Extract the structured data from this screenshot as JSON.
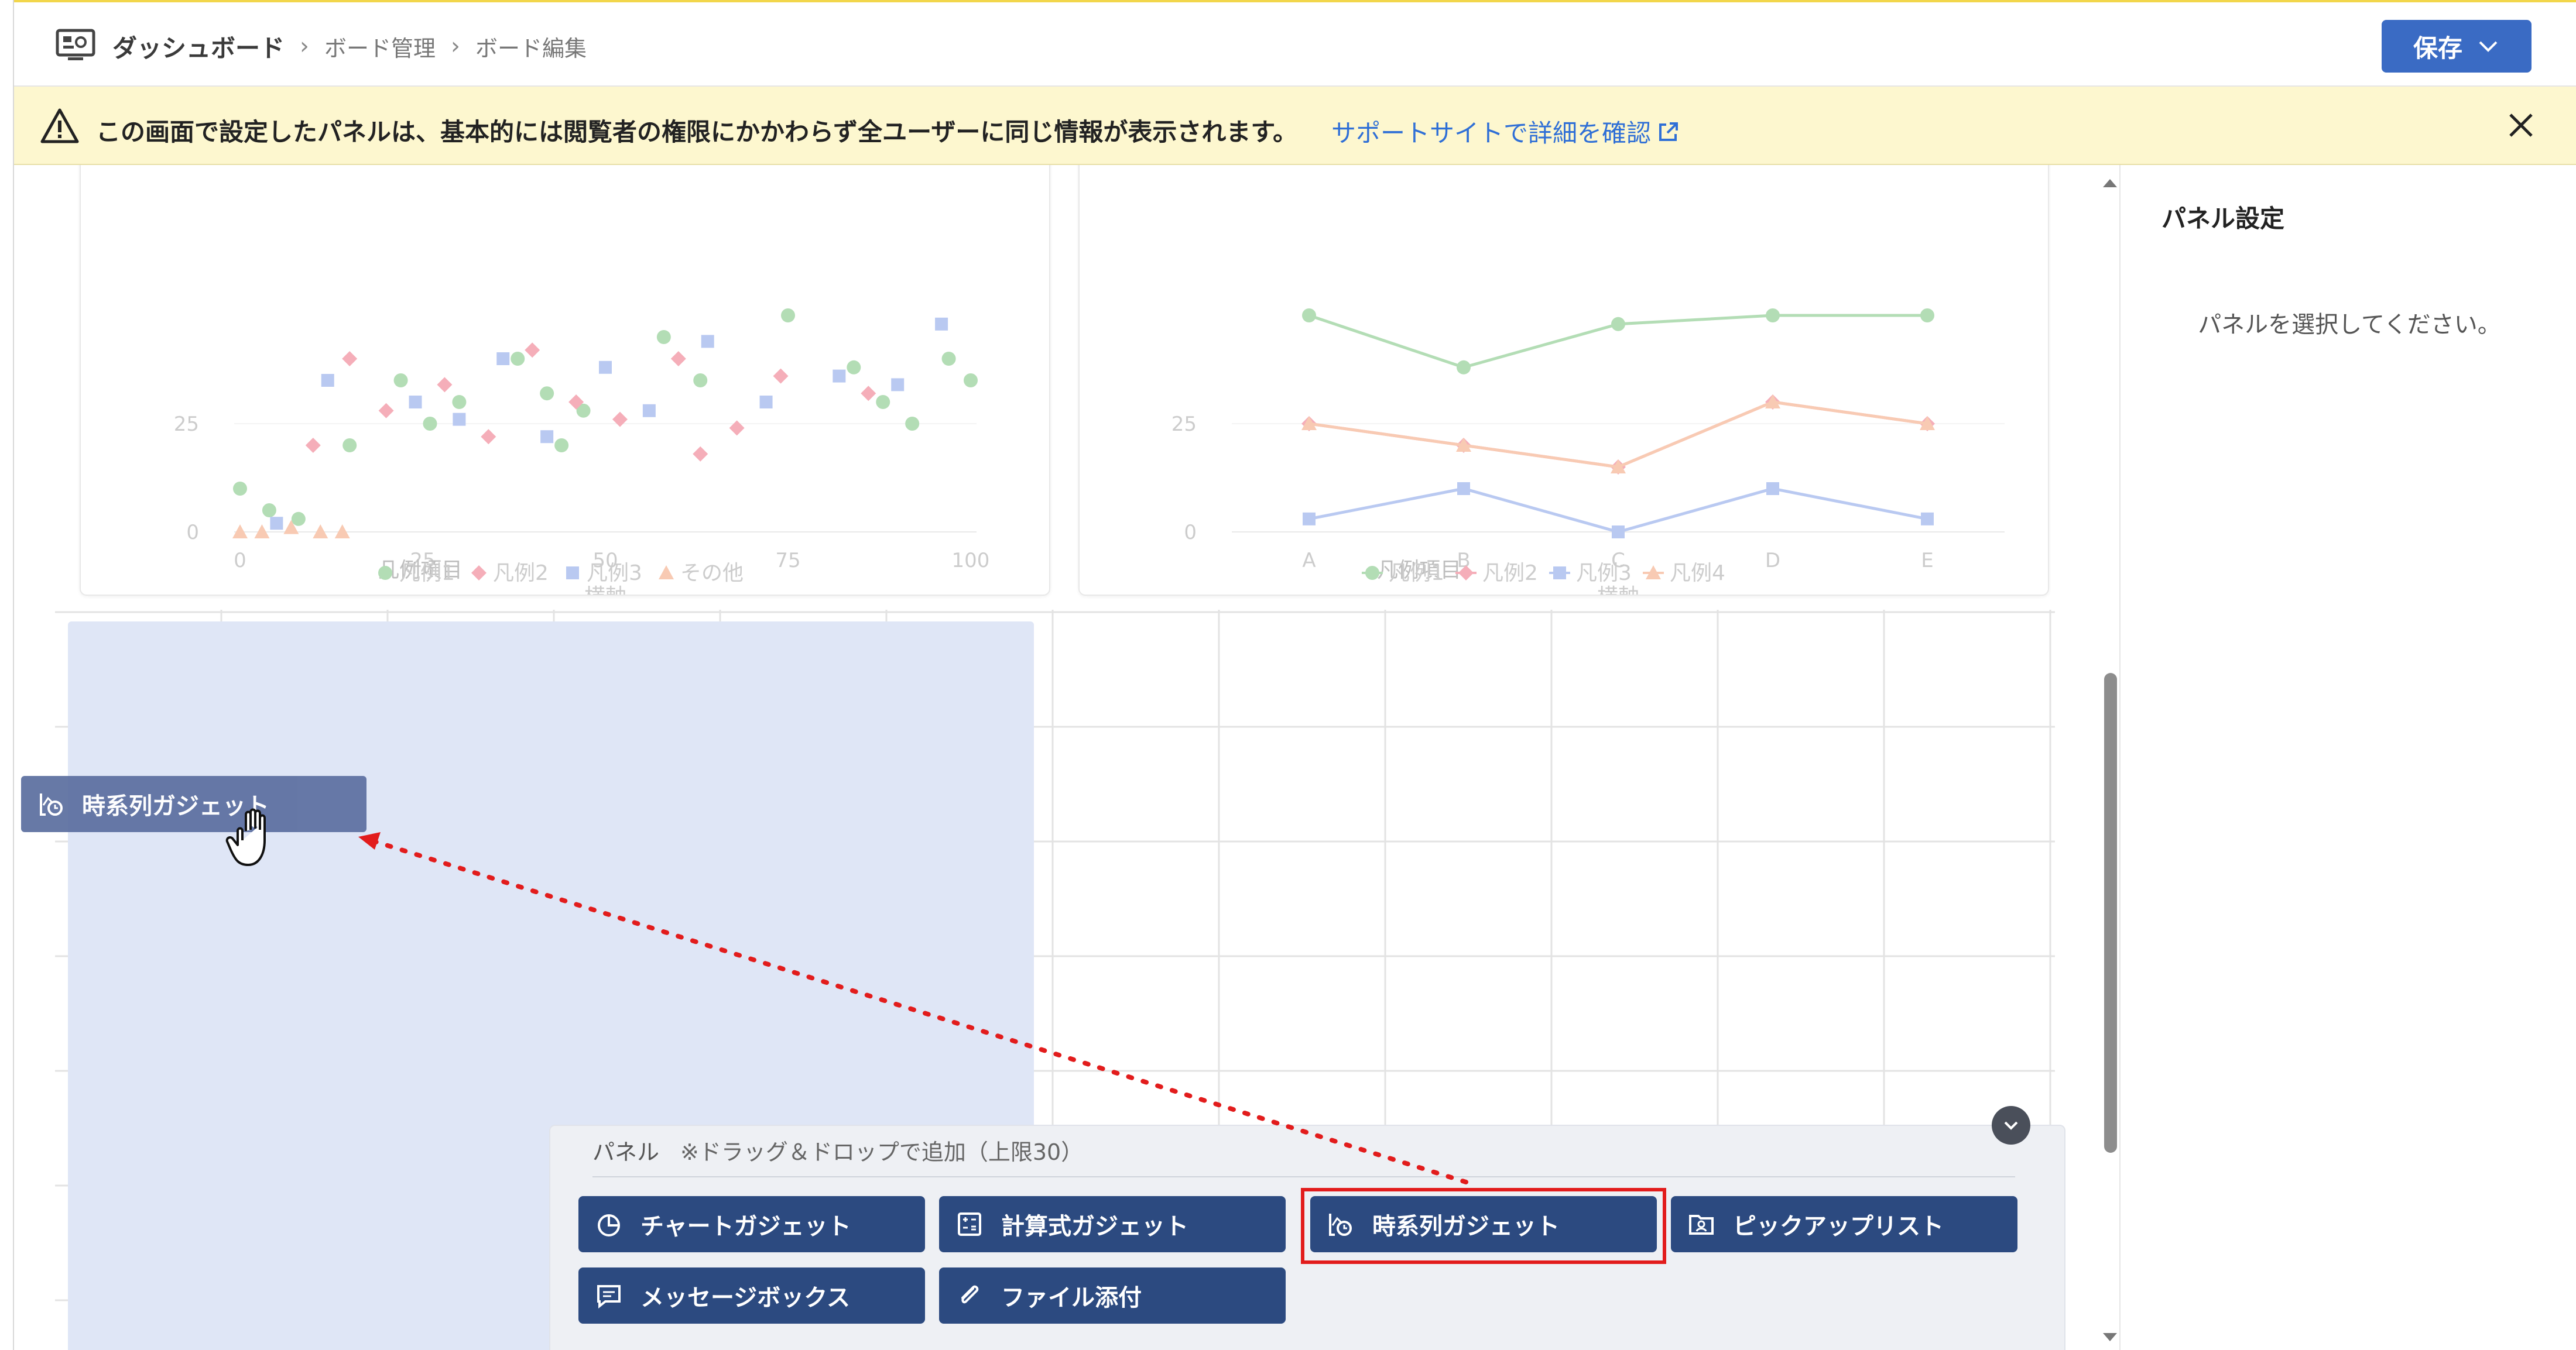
{
  "header": {
    "breadcrumb_root": "ダッシュボード",
    "breadcrumb_items": [
      "ボード管理",
      "ボード編集"
    ],
    "save_label": "保存"
  },
  "notice": {
    "text": "この画面で設定したパネルは、基本的には閲覧者の権限にかかわらず全ユーザーに同じ情報が表示されます。",
    "link_text": "サポートサイトで詳細を確認"
  },
  "chart_data": [
    {
      "type": "scatter",
      "xlabel": "横軸",
      "x_ticks": [
        "0",
        "25",
        "50",
        "75",
        "100"
      ],
      "y_ticks": [
        "0",
        "25"
      ],
      "legend_title": "凡例項目",
      "legend": [
        "凡例1",
        "凡例2",
        "凡例3",
        "その他"
      ],
      "series": [
        {
          "name": "凡例1",
          "x": [
            0,
            4,
            8,
            15,
            22,
            26,
            30,
            38,
            42,
            44,
            47,
            58,
            63,
            75,
            84,
            88,
            92,
            97,
            100
          ],
          "y": [
            10,
            5,
            3,
            20,
            35,
            25,
            30,
            40,
            32,
            20,
            28,
            45,
            35,
            50,
            38,
            30,
            25,
            40,
            35
          ]
        },
        {
          "name": "凡例2",
          "x": [
            10,
            15,
            20,
            28,
            34,
            40,
            46,
            52,
            60,
            63,
            68,
            74,
            86
          ],
          "y": [
            20,
            40,
            28,
            34,
            22,
            42,
            30,
            26,
            40,
            18,
            24,
            36,
            32
          ]
        },
        {
          "name": "凡例3",
          "x": [
            5,
            12,
            24,
            30,
            36,
            42,
            50,
            56,
            64,
            72,
            82,
            90,
            96
          ],
          "y": [
            2,
            35,
            30,
            26,
            40,
            22,
            38,
            28,
            44,
            30,
            36,
            34,
            48
          ]
        },
        {
          "name": "その他",
          "x": [
            0,
            3,
            7,
            11,
            14
          ],
          "y": [
            0,
            0,
            1,
            0,
            0
          ]
        }
      ]
    },
    {
      "type": "line",
      "xlabel": "横軸",
      "categories": [
        "A",
        "B",
        "C",
        "D",
        "E"
      ],
      "y_ticks": [
        "0",
        "25"
      ],
      "legend_title": "凡例項目",
      "legend": [
        "凡例1",
        "凡例2",
        "凡例3",
        "凡例4"
      ],
      "series": [
        {
          "name": "凡例1",
          "values": [
            50,
            38,
            48,
            50,
            50
          ]
        },
        {
          "name": "凡例2",
          "values": [
            25,
            20,
            15,
            30,
            25
          ]
        },
        {
          "name": "凡例4",
          "values": [
            25,
            20,
            15,
            30,
            25
          ]
        },
        {
          "name": "凡例3",
          "values": [
            3,
            10,
            0,
            10,
            3
          ]
        }
      ]
    }
  ],
  "panel_settings": {
    "title": "パネル設定",
    "empty_message": "パネルを選択してください。"
  },
  "tray": {
    "title": "パネル",
    "note": "※ドラッグ＆ドロップで追加（上限30）",
    "buttons": [
      {
        "label": "チャートガジェット",
        "icon": "pie-chart-icon"
      },
      {
        "label": "計算式ガジェット",
        "icon": "calculator-icon"
      },
      {
        "label": "時系列ガジェット",
        "icon": "timeseries-icon"
      },
      {
        "label": "ピックアップリスト",
        "icon": "folder-user-icon"
      },
      {
        "label": "メッセージボックス",
        "icon": "message-icon"
      },
      {
        "label": "ファイル添付",
        "icon": "paperclip-icon"
      }
    ]
  },
  "drag_ghost": {
    "label": "時系列ガジェット"
  },
  "colors": {
    "accent": "#3a6bc4",
    "gadget_button": "#2c4a80",
    "highlight": "#e21c1c",
    "notice_bg": "#fdf7cf",
    "drop_target": "#dfe6f6"
  }
}
